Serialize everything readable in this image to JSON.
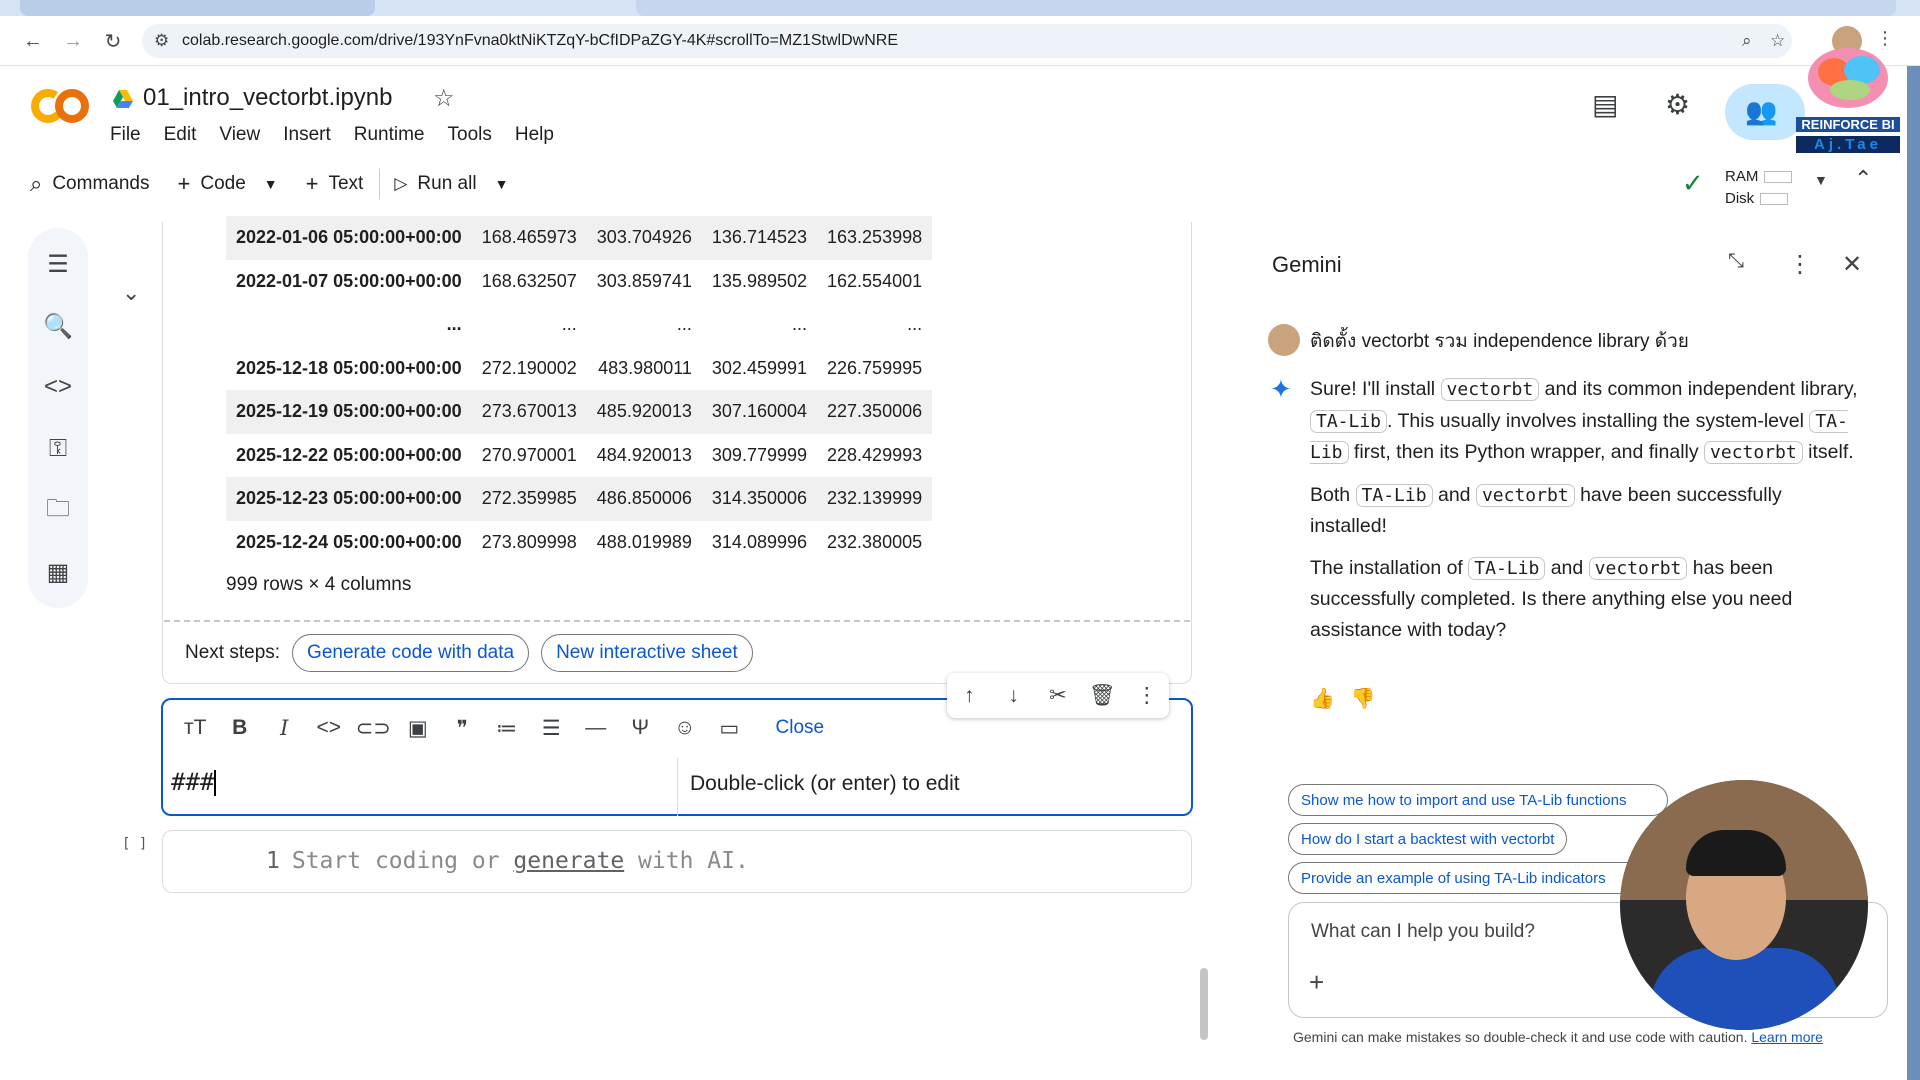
{
  "browser": {
    "url": "colab.research.google.com/drive/193YnFvna0ktNiKTZqY-bCfIDPaZGY-4K#scrollTo=MZ1StwlDwNRE"
  },
  "colab": {
    "notebook_title": "01_intro_vectorbt.ipynb",
    "menu": [
      "File",
      "Edit",
      "View",
      "Insert",
      "Runtime",
      "Tools",
      "Help"
    ],
    "toolbar": {
      "commands": "Commands",
      "code": "Code",
      "text": "Text",
      "run_all": "Run all"
    },
    "resources": {
      "ram": "RAM",
      "disk": "Disk"
    }
  },
  "output": {
    "table": {
      "rows": [
        {
          "idx": "2022-01-06 05:00:00+00:00",
          "c1": "168.465973",
          "c2": "303.704926",
          "c3": "136.714523",
          "c4": "163.253998"
        },
        {
          "idx": "2022-01-07 05:00:00+00:00",
          "c1": "168.632507",
          "c2": "303.859741",
          "c3": "135.989502",
          "c4": "162.554001"
        },
        {
          "idx": "...",
          "c1": "...",
          "c2": "...",
          "c3": "...",
          "c4": "..."
        },
        {
          "idx": "2025-12-18 05:00:00+00:00",
          "c1": "272.190002",
          "c2": "483.980011",
          "c3": "302.459991",
          "c4": "226.759995"
        },
        {
          "idx": "2025-12-19 05:00:00+00:00",
          "c1": "273.670013",
          "c2": "485.920013",
          "c3": "307.160004",
          "c4": "227.350006"
        },
        {
          "idx": "2025-12-22 05:00:00+00:00",
          "c1": "270.970001",
          "c2": "484.920013",
          "c3": "309.779999",
          "c4": "228.429993"
        },
        {
          "idx": "2025-12-23 05:00:00+00:00",
          "c1": "272.359985",
          "c2": "486.850006",
          "c3": "314.350006",
          "c4": "232.139999"
        },
        {
          "idx": "2025-12-24 05:00:00+00:00",
          "c1": "273.809998",
          "c2": "488.019989",
          "c3": "314.089996",
          "c4": "232.380005"
        }
      ]
    },
    "shape": "999 rows × 4 columns",
    "next_steps_label": "Next steps:",
    "next_steps_chips": [
      "Generate code with data",
      "New interactive sheet"
    ]
  },
  "text_cell": {
    "close_label": "Close",
    "input_value": "###",
    "preview_placeholder": "Double-click (or enter) to edit"
  },
  "code_cell": {
    "run_indicator": "[ ]",
    "line_number": "1",
    "placeholder_pre": "Start coding or ",
    "placeholder_link": "generate",
    "placeholder_post": " with AI."
  },
  "gemini": {
    "title": "Gemini",
    "user_message": "ติดตั้ง vectorbt รวม independence library ด้วย",
    "response": {
      "p1": {
        "t1": "Sure! I'll install ",
        "c1": "vectorbt",
        "t2": " and its common independent library, ",
        "c2": "TA-Lib",
        "t3": ". This usually involves installing the system-level ",
        "c3": "TA-Lib",
        "t4": " first, then its Python wrapper, and finally ",
        "c4": "vectorbt",
        "t5": " itself."
      },
      "p2": {
        "t1": "Both ",
        "c1": "TA-Lib",
        "t2": " and ",
        "c2": "vectorbt",
        "t3": " have been successfully installed!"
      },
      "p3": {
        "t1": "The installation of ",
        "c1": "TA-Lib",
        "t2": " and ",
        "c2": "vectorbt",
        "t3": " has been successfully completed. Is there anything else you need assistance with today?"
      }
    },
    "suggestions": [
      "Show me how to import and use TA-Lib functions",
      "How do I start a backtest with vectorbt",
      "Provide an example of using TA-Lib indicators"
    ],
    "prompt_placeholder": "What can I help you build?",
    "disclaimer_text": "Gemini can make mistakes so double-check it and use code with caution.",
    "disclaimer_link": "Learn more"
  },
  "overlay": {
    "brand_line1": "REINFORCE BI",
    "brand_line2": "Aj.Tae"
  },
  "colors": {
    "accent_blue": "#0b57d0",
    "share_bg": "#c2e7ff",
    "ok_green": "#188038",
    "colab_orange": "#f9ab00"
  },
  "icons": {
    "rail": [
      "table-of-contents-icon",
      "find-replace-icon",
      "code-snippets-icon",
      "secrets-key-icon",
      "files-folder-icon",
      "data-table-icon"
    ],
    "format_bar": [
      "text-size-icon",
      "bold-icon",
      "italic-icon",
      "code-icon",
      "link-icon",
      "image-icon",
      "quote-icon",
      "numbered-list-icon",
      "bullet-list-icon",
      "horizontal-rule-icon",
      "latex-psi-icon",
      "emoji-icon",
      "table-insert-icon"
    ],
    "cell_tools": [
      "move-up-icon",
      "move-down-icon",
      "cut-icon",
      "delete-icon",
      "more-vert-icon"
    ]
  }
}
